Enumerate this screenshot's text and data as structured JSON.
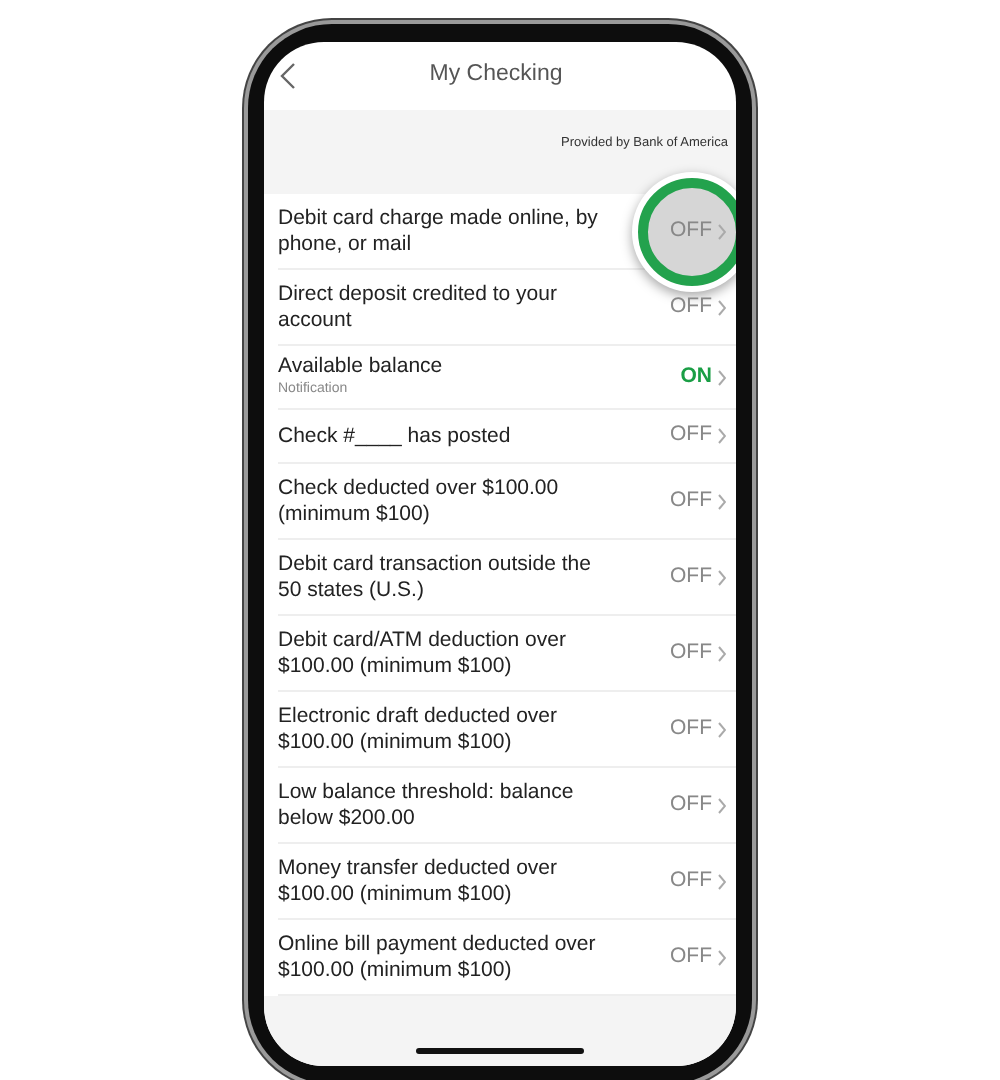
{
  "header": {
    "title": "My Checking"
  },
  "provider": "Provided by Bank of America",
  "alerts": [
    {
      "label": "Debit card charge made online, by phone, or mail",
      "status": "OFF",
      "on": false,
      "highlighted": true
    },
    {
      "label": "Direct deposit credited to your account",
      "status": "OFF",
      "on": false,
      "highlighted": false
    },
    {
      "label": "Available balance",
      "sublabel": "Notification",
      "status": "ON",
      "on": true,
      "highlighted": false
    },
    {
      "label": "Check #____ has posted",
      "status": "OFF",
      "on": false,
      "highlighted": false
    },
    {
      "label": "Check deducted over $100.00 (minimum $100)",
      "status": "OFF",
      "on": false,
      "highlighted": false
    },
    {
      "label": "Debit card transaction outside the 50 states (U.S.)",
      "status": "OFF",
      "on": false,
      "highlighted": false
    },
    {
      "label": "Debit card/ATM deduction over $100.00 (minimum $100)",
      "status": "OFF",
      "on": false,
      "highlighted": false
    },
    {
      "label": "Electronic draft deducted over $100.00 (minimum $100)",
      "status": "OFF",
      "on": false,
      "highlighted": false
    },
    {
      "label": "Low balance threshold: balance below $200.00",
      "status": "OFF",
      "on": false,
      "highlighted": false
    },
    {
      "label": "Money transfer deducted over $100.00 (minimum $100)",
      "status": "OFF",
      "on": false,
      "highlighted": false
    },
    {
      "label": "Online bill payment deducted over $100.00 (minimum $100)",
      "status": "OFF",
      "on": false,
      "highlighted": false
    }
  ]
}
